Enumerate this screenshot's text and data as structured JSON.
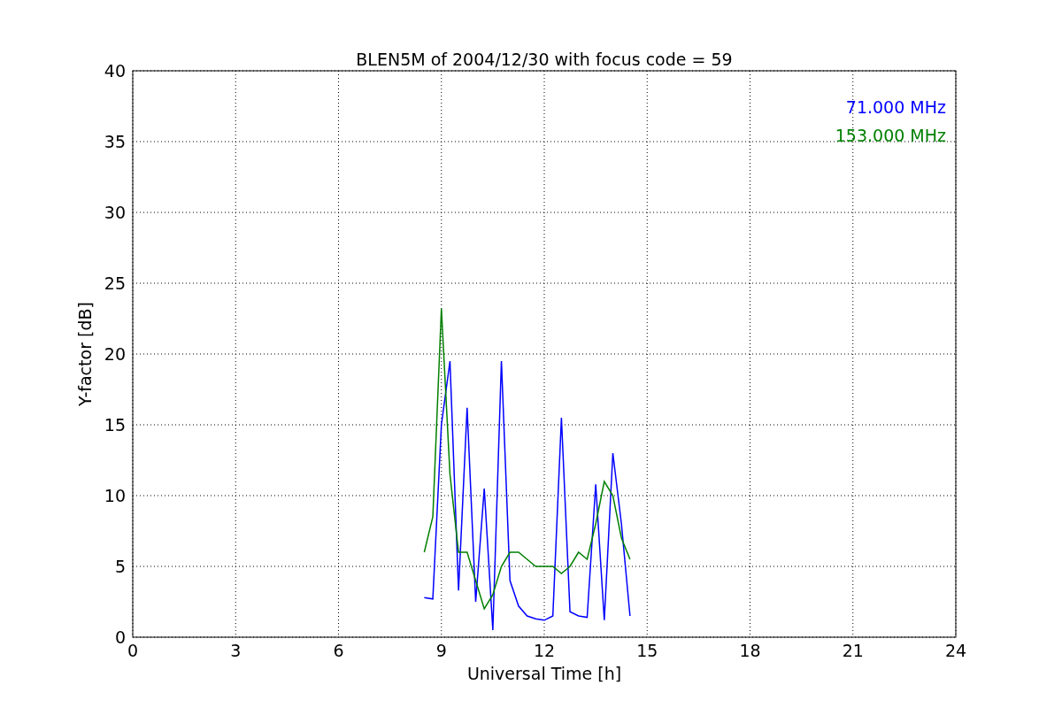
{
  "chart_data": {
    "type": "line",
    "title": "BLEN5M of 2004/12/30 with focus code = 59",
    "xlabel": "Universal Time [h]",
    "ylabel": "Y-factor [dB]",
    "x": [
      8.5,
      8.75,
      9,
      9.25,
      9.5,
      9.75,
      10,
      10.25,
      10.5,
      10.75,
      11,
      11.25,
      11.5,
      11.75,
      12,
      12.25,
      12.5,
      12.75,
      13,
      13.25,
      13.5,
      13.75,
      14,
      14.25,
      14.5
    ],
    "series": [
      {
        "name": "71.000 MHz",
        "color": "#0000ff",
        "values": [
          2.8,
          2.7,
          15,
          19.5,
          3.3,
          16.2,
          2.5,
          10.5,
          0.5,
          19.5,
          4,
          2.2,
          1.5,
          1.3,
          1.2,
          1.5,
          15.5,
          1.8,
          1.5,
          1.4,
          10.8,
          1.2,
          13,
          8,
          1.5
        ]
      },
      {
        "name": "153.000 MHz",
        "color": "#008000",
        "values": [
          6,
          8.5,
          23.2,
          11.5,
          6,
          6,
          4,
          2,
          3,
          5,
          6,
          6,
          5.5,
          5,
          5,
          5,
          4.5,
          5,
          6,
          5.5,
          8,
          11,
          10,
          7,
          5.5
        ]
      }
    ],
    "grid": true,
    "xlim": [
      0,
      24
    ],
    "ylim": [
      0,
      40
    ],
    "xticks": [
      0,
      3,
      6,
      9,
      12,
      15,
      18,
      21,
      24
    ],
    "yticks": [
      0,
      5,
      10,
      15,
      20,
      25,
      30,
      35,
      40
    ]
  }
}
